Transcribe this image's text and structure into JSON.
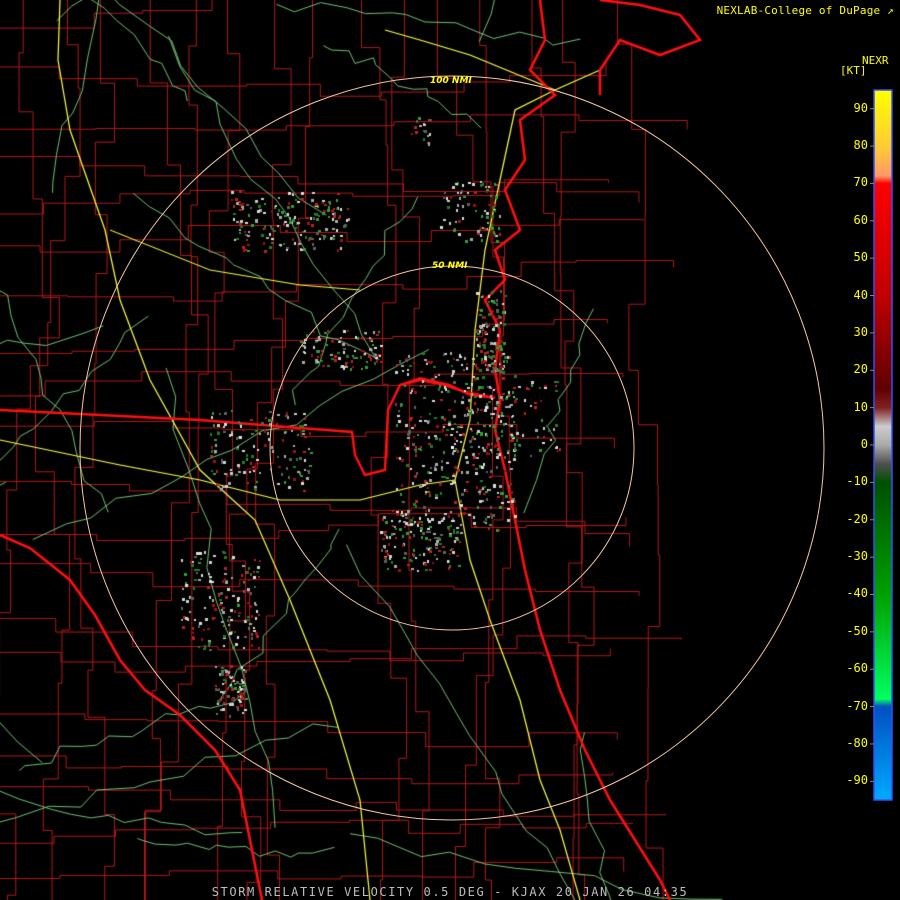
{
  "credit": "NEXLAB-College of DuPage",
  "credit_icon": "external-link-icon",
  "title": "STORM RELATIVE VELOCITY 0.5 DEG - KJAX 20 JAN 26 04:35",
  "rings": [
    "100 NMI",
    "50 NMI"
  ],
  "legend": {
    "product": "NEXR",
    "units": "[KT]",
    "ticks": [
      "90",
      "80",
      "70",
      "60",
      "50",
      "40",
      "30",
      "20",
      "10",
      "0",
      "-10",
      "-20",
      "-30",
      "-40",
      "-50",
      "-60",
      "-70",
      "-80",
      "-90"
    ],
    "tick_values": [
      90,
      80,
      70,
      60,
      50,
      40,
      30,
      20,
      10,
      0,
      -10,
      -20,
      -30,
      -40,
      -50,
      -60,
      -70,
      -80,
      -90
    ],
    "range": [
      -95,
      95
    ],
    "stops": [
      {
        "kt": 95,
        "color": "#ffff00"
      },
      {
        "kt": 80,
        "color": "#ffcc33"
      },
      {
        "kt": 72,
        "color": "#ff9966"
      },
      {
        "kt": 70,
        "color": "#ff0000"
      },
      {
        "kt": 40,
        "color": "#c00000"
      },
      {
        "kt": 15,
        "color": "#600000"
      },
      {
        "kt": 10,
        "color": "#802020"
      },
      {
        "kt": 5,
        "color": "#cccccc"
      },
      {
        "kt": 0,
        "color": "#aaaaaa"
      },
      {
        "kt": -5,
        "color": "#505050"
      },
      {
        "kt": -10,
        "color": "#005000"
      },
      {
        "kt": -40,
        "color": "#00a000"
      },
      {
        "kt": -68,
        "color": "#00ff60"
      },
      {
        "kt": -70,
        "color": "#0050c0"
      },
      {
        "kt": -95,
        "color": "#00aaff"
      }
    ]
  },
  "colors": {
    "background": "#000000",
    "county_lines": "#b01a1a",
    "state_lines": "#ff1010",
    "coastline": "#ff1010",
    "interstates": "#ffff44",
    "highways": "#7fd67f",
    "range_rings": "#f5c6a0",
    "ring_labels": "#ffff00",
    "title": "#bdbdbd",
    "legend_text": "#ffff00"
  }
}
